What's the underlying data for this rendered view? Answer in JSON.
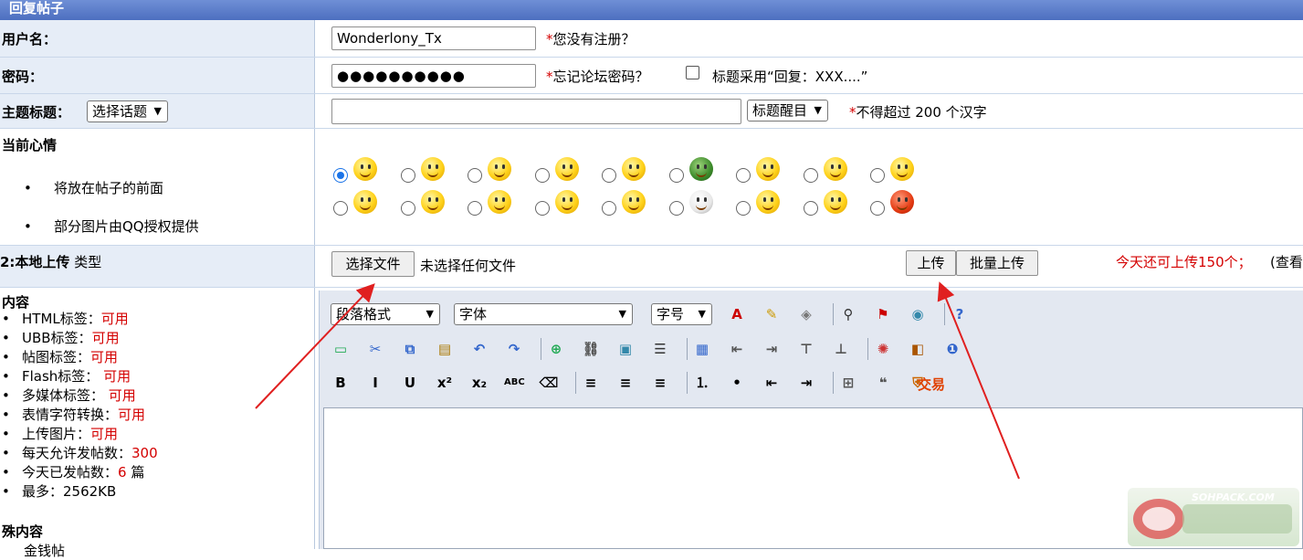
{
  "header": {
    "title": "回复帖子"
  },
  "form": {
    "username": {
      "label": "用户名：",
      "value": "Wonderlony_Tx",
      "note_star": "*",
      "note": "您没有注册？"
    },
    "password": {
      "label": "密码：",
      "value": "●●●●●●●●●●",
      "note_star": "*",
      "note": "忘记论坛密码？",
      "checkbox_label": "标题采用“回复：XXX....”"
    },
    "subject": {
      "label": "主题标题：",
      "topic_select": "选择话题",
      "value": "",
      "style_select": "标题醒目",
      "note_star": "*",
      "note": "不得超过 200 个汉字"
    },
    "mood": {
      "label": "当前心情",
      "bullets": [
        "将放在帖子的前面",
        "部分图片由QQ授权提供"
      ],
      "selected_index": 0
    },
    "upload": {
      "label": "2:本地上传",
      "label_suffix": "类型",
      "choose_button": "选择文件",
      "no_file": "未选择任何文件",
      "upload_button": "上传",
      "batch_button": "批量上传",
      "quota_note": "今天还可上传150个；",
      "view_link": "(查看"
    },
    "content": {
      "label": "内容",
      "rules": [
        {
          "label": "HTML标签：",
          "value": "可用"
        },
        {
          "label": "UBB标签：",
          "value": "可用"
        },
        {
          "label": "帖图标签：",
          "value": "可用"
        },
        {
          "label": "Flash标签：",
          "value": "可用"
        },
        {
          "label": "多媒体标签：",
          "value": "可用"
        },
        {
          "label": "表情字符转换：",
          "value": "可用"
        },
        {
          "label": "上传图片：",
          "value": "可用"
        },
        {
          "label": "每天允许发帖数：",
          "value": "300"
        },
        {
          "label": "今天已发帖数：",
          "value": "6",
          "suffix": " 篇"
        },
        {
          "label": "最多：2562KB",
          "value": ""
        }
      ],
      "special_label": "殊内容",
      "special_item": "金钱帖"
    }
  },
  "editor": {
    "format_select": "段落格式",
    "font_select": "字体",
    "size_select": "字号",
    "trade_label": "交易"
  },
  "watermark": {
    "text": "SOHPACK.COM"
  },
  "colors": {
    "header_bg": "#5b7cc8",
    "label_bg": "#e6edf7",
    "required": "#d40000",
    "arrow": "#e02020"
  }
}
